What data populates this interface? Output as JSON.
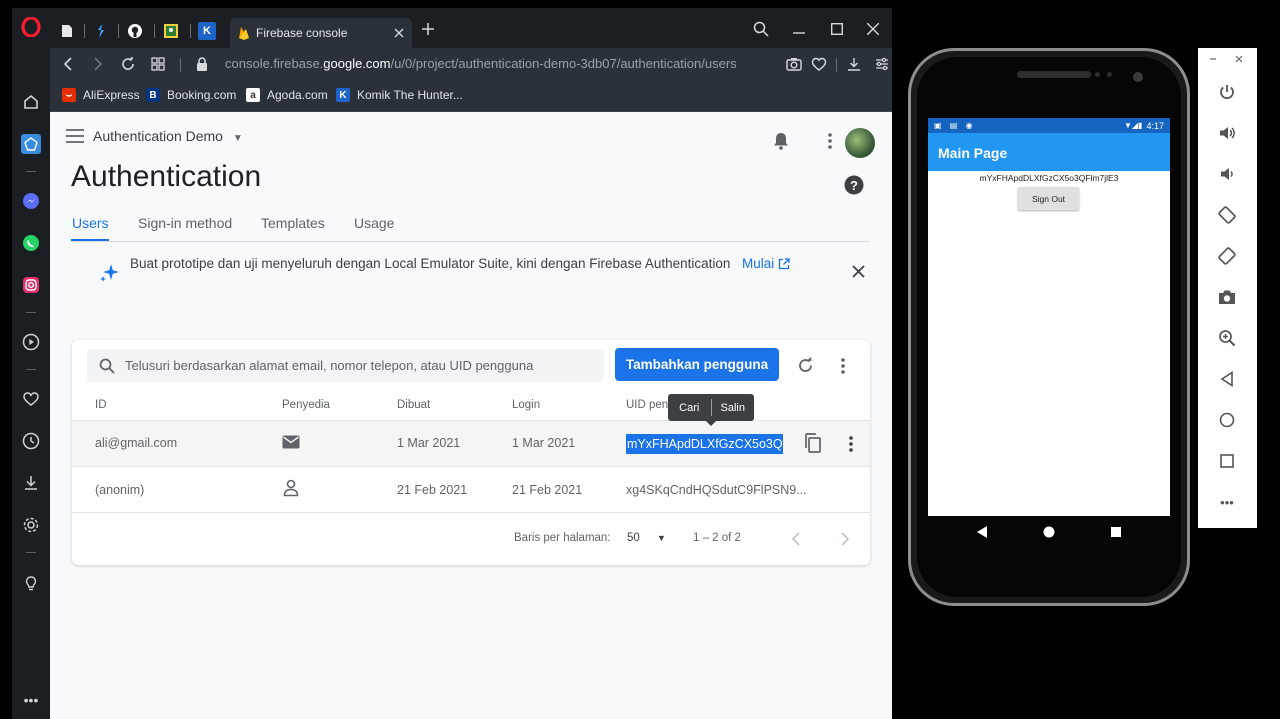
{
  "browser": {
    "active_tab_title": "Firebase console",
    "url_prefix": "console.firebase.",
    "url_domain": "google.com",
    "url_path": "/u/0/project/authentication-demo-3db07/authentication/users",
    "bookmarks": [
      {
        "label": "AliExpress",
        "color": "#e62e04"
      },
      {
        "label": "Booking.com",
        "color": "#003580"
      },
      {
        "label": "Agoda.com",
        "color": "#ffffff"
      },
      {
        "label": "Komik The Hunter...",
        "color": "#1e63c8"
      }
    ]
  },
  "firebase": {
    "project_name": "Authentication Demo",
    "page_title": "Authentication",
    "tabs": [
      "Users",
      "Sign-in method",
      "Templates",
      "Usage"
    ],
    "banner": {
      "text": "Buat prototipe dan uji menyeluruh dengan Local Emulator Suite, kini dengan Firebase Authentication",
      "link": "Mulai"
    },
    "search_placeholder": "Telusuri berdasarkan alamat email, nomor telepon, atau UID pengguna",
    "add_user_label": "Tambahkan pengguna",
    "columns": [
      "ID",
      "Penyedia",
      "Dibuat",
      "Login",
      "UID peng"
    ],
    "rows": [
      {
        "id": "ali@gmail.com",
        "provider_icon": "email-icon",
        "created": "1 Mar 2021",
        "login": "1 Mar 2021",
        "uid": "mYxFHApdDLXfGzCX5o3QFl..."
      },
      {
        "id": "(anonim)",
        "provider_icon": "person-icon",
        "created": "21 Feb 2021",
        "login": "21 Feb 2021",
        "uid": "xg4SKqCndHQSdutC9FlPSN9..."
      }
    ],
    "context_menu": [
      "Cari",
      "Salin"
    ],
    "pagination": {
      "rows_label": "Baris per halaman:",
      "rows_value": "50",
      "range": "1 – 2 of 2"
    },
    "accent_color": "#1a73e8"
  },
  "android": {
    "time": "4:17",
    "app_title": "Main Page",
    "uid": "mYxFHApdDLXfGzCX5o3QFlm7jlE3",
    "sign_out_label": "Sign Out",
    "appbar_color": "#2196f3"
  }
}
